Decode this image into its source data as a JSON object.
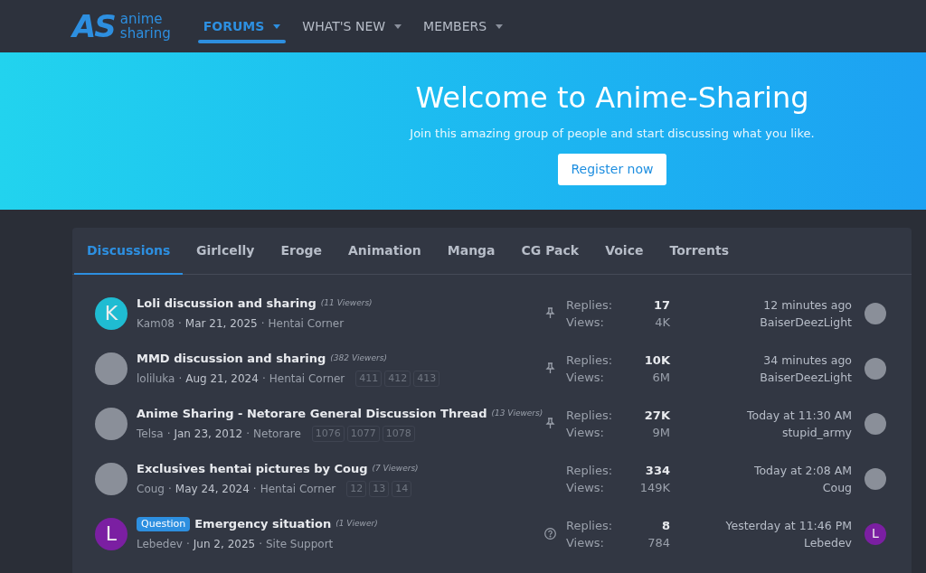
{
  "header": {
    "logo": {
      "mark": "AS",
      "line_1": "anime",
      "line_2": "sharing"
    },
    "nav": [
      {
        "label": "FORUMS",
        "selected": true
      },
      {
        "label": "WHAT'S NEW",
        "selected": false
      },
      {
        "label": "MEMBERS",
        "selected": false
      }
    ]
  },
  "banner": {
    "title": "Welcome to Anime-Sharing",
    "subtitle": "Join this amazing group of people and start discussing what you like.",
    "button": "Register now"
  },
  "tabs": [
    {
      "label": "Discussions",
      "selected": true
    },
    {
      "label": "Girlcelly",
      "selected": false
    },
    {
      "label": "Eroge",
      "selected": false
    },
    {
      "label": "Animation",
      "selected": false
    },
    {
      "label": "Manga",
      "selected": false
    },
    {
      "label": "CG Pack",
      "selected": false
    },
    {
      "label": "Voice",
      "selected": false
    },
    {
      "label": "Torrents",
      "selected": false
    }
  ],
  "threads": [
    {
      "kind": "pinned",
      "avatar": {
        "kind": "letter",
        "letter": "K",
        "color": "#1fbcd2"
      },
      "title": "Loli discussion and sharing",
      "viewers": "(11 Viewers)",
      "author": "Kam08",
      "separator_1": "·",
      "date": "Mar 21, 2025",
      "separator_2": "·",
      "forum": "Hentai Corner",
      "replies_label": "Replies:",
      "replies": "17",
      "views_label": "Views:",
      "views": "4K",
      "last_time": "12 minutes ago",
      "last_user": "BaiserDeezLight",
      "last_avatar": {
        "kind": "image"
      }
    },
    {
      "kind": "pinned",
      "avatar": {
        "kind": "image"
      },
      "title": "MMD discussion and sharing",
      "viewers": "(382 Viewers)",
      "author": "loliluka",
      "separator_1": "·",
      "date": "Aug 21, 2024",
      "separator_2": "·",
      "forum": "Hentai Corner",
      "pages": [
        "411",
        "412",
        "413"
      ],
      "replies_label": "Replies:",
      "replies": "10K",
      "views_label": "Views:",
      "views": "6M",
      "last_time": "34 minutes ago",
      "last_user": "BaiserDeezLight",
      "last_avatar": {
        "kind": "image"
      }
    },
    {
      "kind": "pinned",
      "avatar": {
        "kind": "image"
      },
      "title": "Anime Sharing - Netorare General Discussion Thread",
      "viewers": "(13 Viewers)",
      "author": "Telsa",
      "separator_1": "·",
      "date": "Jan 23, 2012",
      "separator_2": "·",
      "forum": "Netorare",
      "pages": [
        "1076",
        "1077",
        "1078"
      ],
      "replies_label": "Replies:",
      "replies": "27K",
      "views_label": "Views:",
      "views": "9M",
      "last_time": "Today at 11:30 AM",
      "last_user": "stupid_army",
      "last_avatar": {
        "kind": "image"
      }
    },
    {
      "kind": "plain",
      "avatar": {
        "kind": "image"
      },
      "title": "Exclusives hentai pictures by Coug",
      "viewers": "(7 Viewers)",
      "author": "Coug",
      "separator_1": "·",
      "date": "May 24, 2024",
      "separator_2": "·",
      "forum": "Hentai Corner",
      "pages": [
        "12",
        "13",
        "14"
      ],
      "replies_label": "Replies:",
      "replies": "334",
      "views_label": "Views:",
      "views": "149K",
      "last_time": "Today at 2:08 AM",
      "last_user": "Coug",
      "last_avatar": {
        "kind": "image"
      }
    },
    {
      "kind": "question",
      "avatar": {
        "kind": "letter",
        "letter": "L",
        "color": "#7b1fa2"
      },
      "prefix": "Question",
      "title": "Emergency situation",
      "viewers": "(1 Viewer)",
      "author": "Lebedev",
      "separator_1": "·",
      "date": "Jun 2, 2025",
      "separator_2": "·",
      "forum": "Site Support",
      "replies_label": "Replies:",
      "replies": "8",
      "views_label": "Views:",
      "views": "784",
      "last_time": "Yesterday at 11:46 PM",
      "last_user": "Lebedev",
      "last_avatar": {
        "kind": "letter",
        "letter": "L",
        "color": "#7b1fa2"
      }
    }
  ]
}
